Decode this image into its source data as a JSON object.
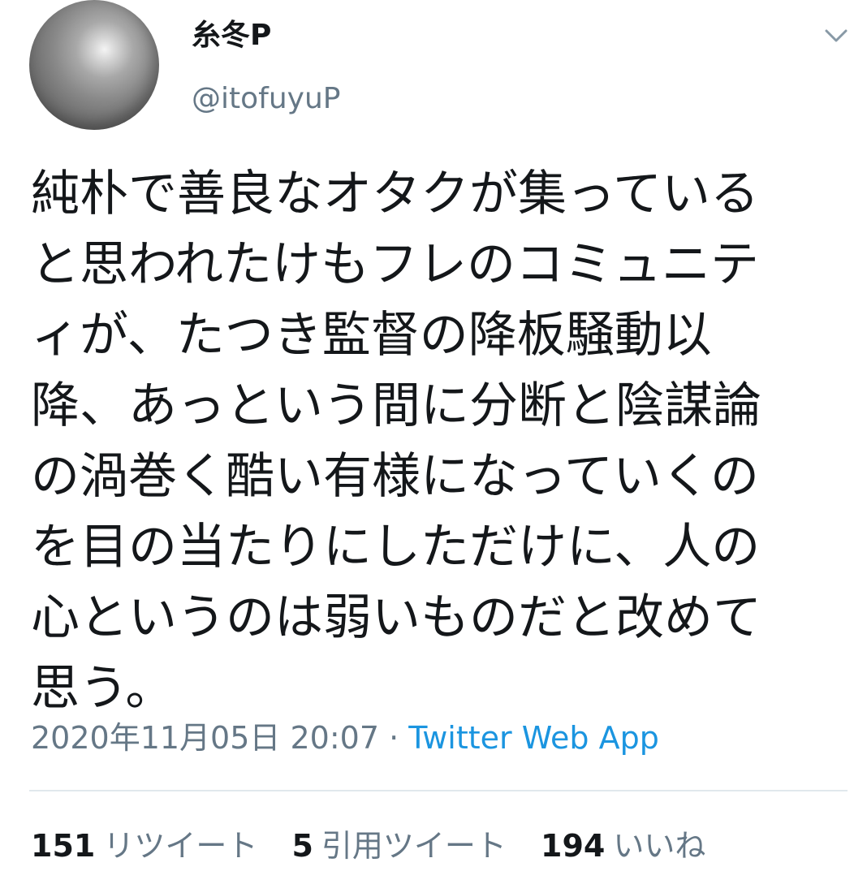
{
  "tweet": {
    "display_name": "糸冬P",
    "handle": "@itofuyuP",
    "text": "純朴で善良なオタクが集っている\nと思われたけもフレのコミュニテ\nィが、たつき監督の降板騒動以\n降、あっという間に分断と陰謀論\nの渦巻く酷い有様になっていくの\nを目の当たりにしただけに、人の\n心というのは弱いものだと改めて\n思う。",
    "timestamp": "2020年11月05日 20:07",
    "separator": " · ",
    "source": "Twitter Web App"
  },
  "stats": {
    "retweets_count": "151",
    "retweets_label": "リツイート",
    "quotes_count": "5",
    "quotes_label": "引用ツイート",
    "likes_count": "194",
    "likes_label": "いいね"
  },
  "icons": {
    "menu": "chevron-down-icon",
    "avatar": "avatar"
  },
  "colors": {
    "text": "#14171a",
    "secondary": "#657786",
    "link": "#1b95e0",
    "divider": "#e1e8ed"
  }
}
